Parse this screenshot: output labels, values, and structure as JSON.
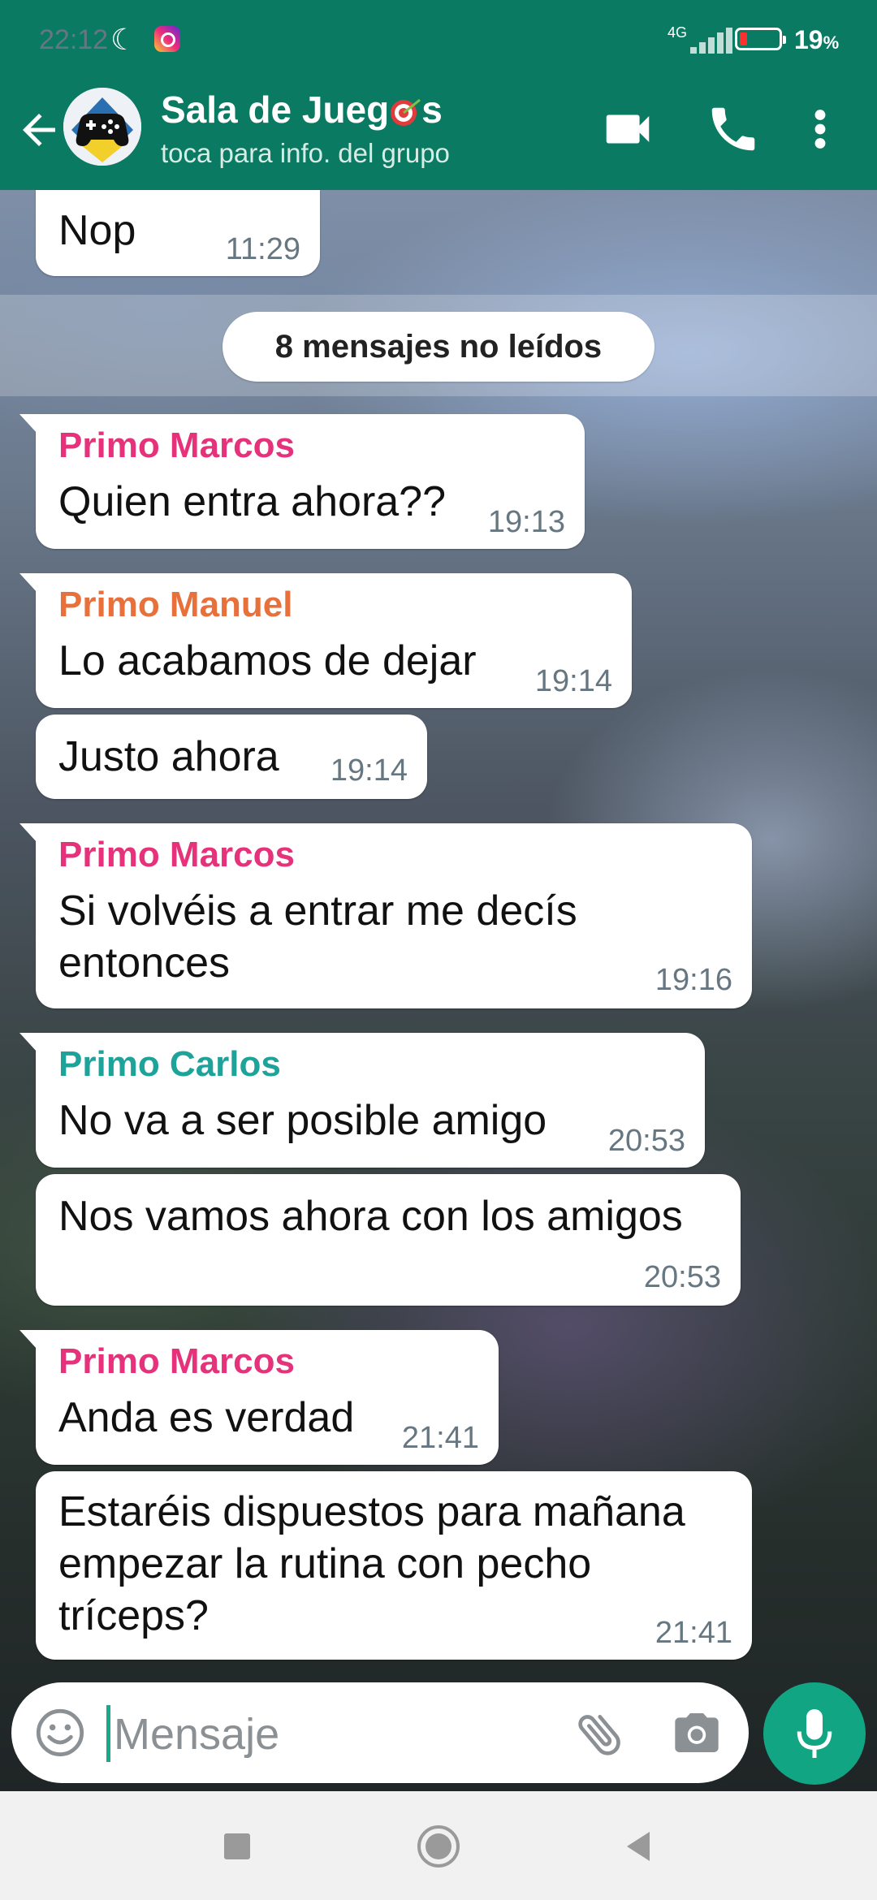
{
  "status_bar": {
    "time": "22:12",
    "network": "4G",
    "battery_percent": "19",
    "battery_unit": "%",
    "battery_level": 0.19
  },
  "header": {
    "title_part1": "Sala de Jueg",
    "title_part2": "s",
    "subtitle": "toca para info. del grupo"
  },
  "messages": [
    {
      "sender": "",
      "text": "Nop",
      "time": "11:29"
    },
    {
      "sender": "Primo Marcos",
      "sender_color": "#e5327a",
      "text": "Quien entra ahora??",
      "time": "19:13"
    },
    {
      "sender": "Primo Manuel",
      "sender_color": "#e8703a",
      "text": "Lo acabamos de dejar",
      "time": "19:14"
    },
    {
      "sender": "",
      "text": "Justo ahora",
      "time": "19:14"
    },
    {
      "sender": "Primo Marcos",
      "sender_color": "#e5327a",
      "text_line1": "Si volvéis a entrar me decís",
      "text_line2": "entonces",
      "time": "19:16"
    },
    {
      "sender": "Primo Carlos",
      "sender_color": "#1ea39a",
      "text": "No va a ser posible amigo",
      "time": "20:53"
    },
    {
      "sender": "",
      "text": "Nos vamos ahora con los amigos",
      "time": "20:53"
    },
    {
      "sender": "Primo Marcos",
      "sender_color": "#e5327a",
      "text": "Anda es verdad",
      "time": "21:41"
    },
    {
      "sender": "",
      "text_line1": "Estaréis dispuestos para mañana",
      "text_line2": "empezar la rutina con pecho",
      "text_line3": "tríceps?",
      "time": "21:41"
    }
  ],
  "unread_label": "8 mensajes no leídos",
  "composer": {
    "placeholder": "Mensaje"
  },
  "icons": {
    "back": "arrow-left-icon",
    "video": "video-camera-icon",
    "call": "phone-icon",
    "menu": "more-vertical-icon",
    "emoji": "emoji-icon",
    "attach": "paperclip-icon",
    "camera": "camera-icon",
    "mic": "microphone-icon"
  },
  "colors": {
    "header": "#0a7a63",
    "accent": "#12a584"
  }
}
